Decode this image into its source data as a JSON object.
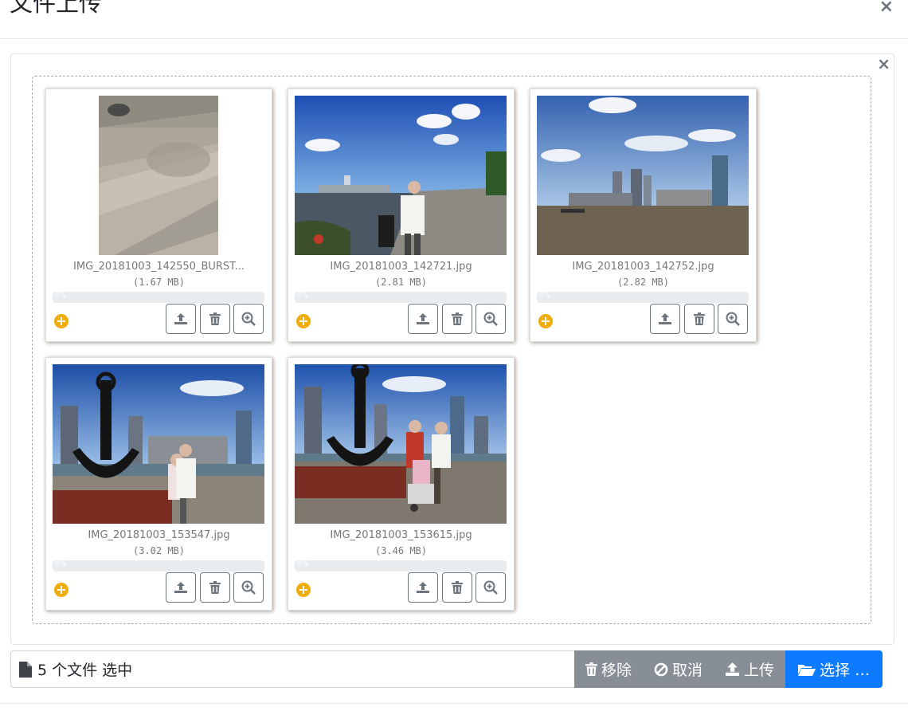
{
  "modal": {
    "title": "文件上传",
    "close_symbol": "×"
  },
  "preview": {
    "close_symbol": "×",
    "files": [
      {
        "name": "IMG_20181003_142550_BURST...",
        "size": "(1.67 MB)",
        "progress_text": "0%",
        "photo": "portrait-pavement"
      },
      {
        "name": "IMG_20181003_142721.jpg",
        "size": "(2.81 MB)",
        "progress_text": "0%",
        "photo": "riverside-man"
      },
      {
        "name": "IMG_20181003_142752.jpg",
        "size": "(2.82 MB)",
        "progress_text": "0%",
        "photo": "skyline-river"
      },
      {
        "name": "IMG_20181003_153547.jpg",
        "size": "(3.02 MB)",
        "progress_text": "0%",
        "photo": "anchor-couple"
      },
      {
        "name": "IMG_20181003_153615.jpg",
        "size": "(3.46 MB)",
        "progress_text": "0%",
        "photo": "anchor-family"
      }
    ]
  },
  "caption": {
    "text": "5 个文件 选中",
    "icon": "file-icon"
  },
  "buttons": {
    "remove": "移除",
    "cancel": "取消",
    "upload": "上传",
    "browse": "选择 …"
  },
  "colors": {
    "browse": "#0d7bff",
    "action_gray": "#888e95",
    "status_pending": "#f0ad0e"
  }
}
